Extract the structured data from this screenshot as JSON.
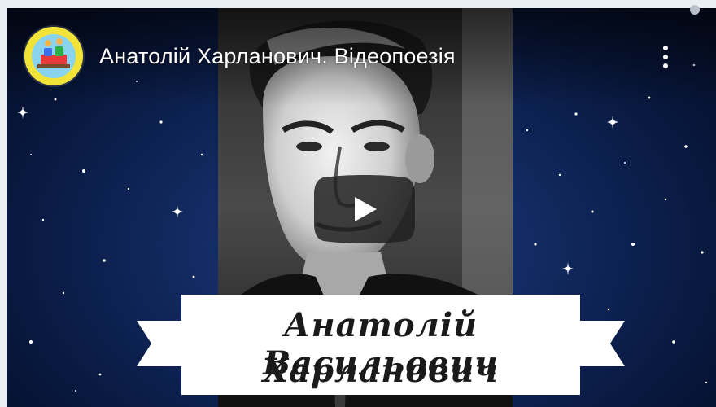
{
  "video": {
    "title": "Анатолій Харланович. Відеопоезія",
    "banner": {
      "line1": "Анатолій Васильович",
      "line2": "Харланович"
    }
  },
  "icons": {
    "channel_avatar": "channel-avatar-icon",
    "menu": "more-vert-icon",
    "play": "youtube-play-icon"
  },
  "colors": {
    "play_button_bg": "#212121",
    "background_navy": "#0f2558",
    "avatar_bg": "#f0e23a"
  }
}
